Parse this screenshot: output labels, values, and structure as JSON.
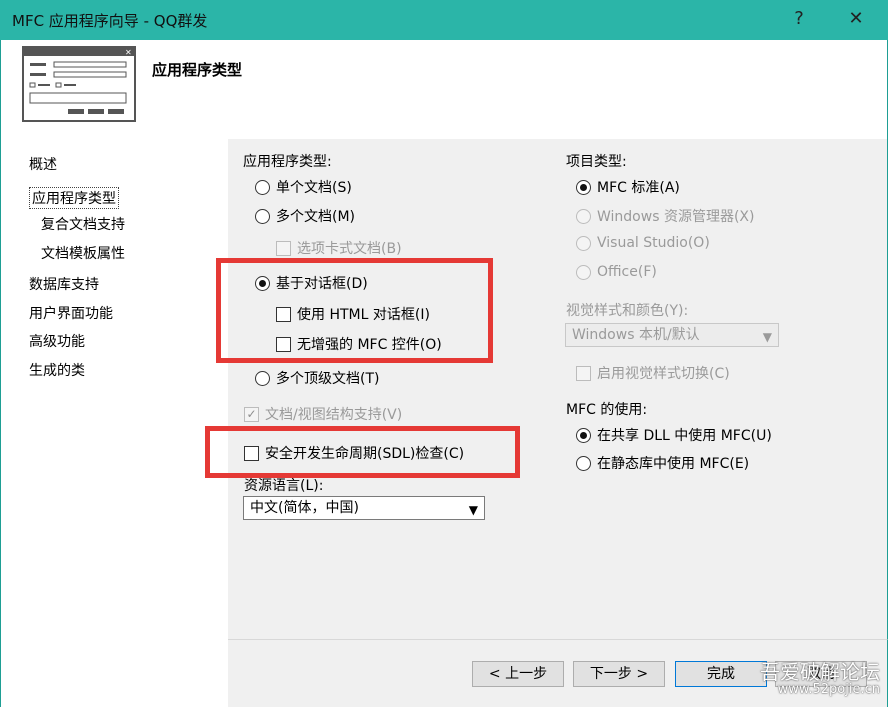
{
  "window": {
    "title": "MFC 应用程序向导 - QQ群发",
    "help_glyph": "?",
    "close_glyph": "✕"
  },
  "header": {
    "heading": "应用程序类型"
  },
  "nav": {
    "items": [
      {
        "label": "概述"
      },
      {
        "label": "应用程序类型"
      },
      {
        "label": "复合文档支持"
      },
      {
        "label": "文档模板属性"
      },
      {
        "label": "数据库支持"
      },
      {
        "label": "用户界面功能"
      },
      {
        "label": "高级功能"
      },
      {
        "label": "生成的类"
      }
    ]
  },
  "app_type": {
    "label": "应用程序类型:",
    "single_doc": "单个文档(S)",
    "multi_doc": "多个文档(M)",
    "tabbed_docs": "选项卡式文档(B)",
    "dialog_based": "基于对话框(D)",
    "html_dialog": "使用 HTML 对话框(I)",
    "no_enhanced_mfc": "无增强的 MFC 控件(O)",
    "multi_toplevel": "多个顶级文档(T)",
    "doc_view": "文档/视图结构支持(V)",
    "doc_view_check": "✓",
    "sdl": "安全开发生命周期(SDL)检查(C)",
    "resource_lang_label": "资源语言(L):",
    "resource_lang_value": "中文(简体，中国)"
  },
  "project_type": {
    "label": "项目类型:",
    "mfc_standard": "MFC 标准(A)",
    "explorer": "Windows 资源管理器(X)",
    "visual_studio": "Visual Studio(O)",
    "office": "Office(F)",
    "visual_style_label": "视觉样式和颜色(Y):",
    "visual_style_value": "Windows 本机/默认",
    "visual_style_switch": "启用视觉样式切换(C)",
    "mfc_use_label": "MFC 的使用:",
    "shared_dll": "在共享 DLL 中使用 MFC(U)",
    "static_lib": "在静态库中使用 MFC(E)"
  },
  "buttons": {
    "prev": "< 上一步",
    "next": "下一步 >",
    "finish": "完成",
    "cancel": "取消"
  },
  "watermark": {
    "line1": "吾爱破解论坛",
    "line2": "www.52pojie.cn"
  },
  "colors": {
    "titlebar": "#2bb5a8",
    "highlight_box": "#e53935"
  },
  "icons": {
    "dropdown": "chevron-down-icon",
    "wizard": "wizard-dialog-icon"
  }
}
